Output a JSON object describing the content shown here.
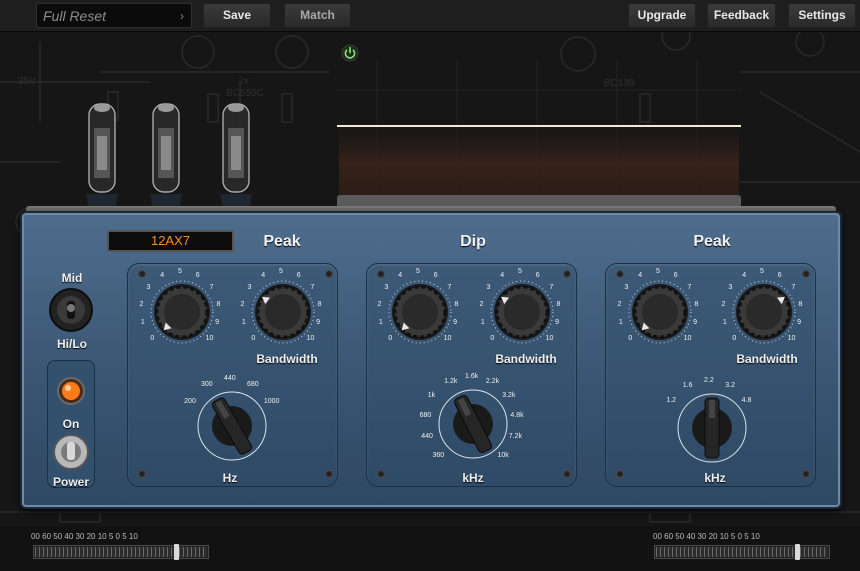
{
  "toolbar": {
    "preset_name": "Full Reset",
    "save_label": "Save",
    "match_label": "Match",
    "upgrade_label": "Upgrade",
    "feedback_label": "Feedback",
    "settings_label": "Settings"
  },
  "schematic_text": {
    "v35": "35V",
    "label_bc": "BC550C",
    "label_2x": "2x",
    "label_bd": "BD139"
  },
  "tube_type": "12AX7",
  "left_controls": {
    "mid_label": "Mid",
    "hilo_label": "Hi/Lo",
    "on_label": "On",
    "power_label": "Power"
  },
  "bands": [
    {
      "title": "Peak",
      "gain_ticks": [
        "0",
        "1",
        "2",
        "3",
        "4",
        "5",
        "6",
        "7",
        "8",
        "9",
        "10"
      ],
      "gain_value": 0,
      "bandwidth_label": "Bandwidth",
      "bandwidth_ticks": [
        "0",
        "1",
        "2",
        "3",
        "4",
        "5",
        "6",
        "7",
        "8",
        "9",
        "10"
      ],
      "bandwidth_value": 3,
      "freq_ticks": [
        "200",
        "300",
        "440",
        "680",
        "1000"
      ],
      "freq_value": "300",
      "freq_unit": "Hz"
    },
    {
      "title": "Dip",
      "gain_ticks": [
        "0",
        "1",
        "2",
        "3",
        "4",
        "5",
        "6",
        "7",
        "8",
        "9",
        "10"
      ],
      "gain_value": 0,
      "bandwidth_label": "Bandwidth",
      "bandwidth_ticks": [
        "0",
        "1",
        "2",
        "3",
        "4",
        "5",
        "6",
        "7",
        "8",
        "9",
        "10"
      ],
      "bandwidth_value": 3,
      "freq_ticks": [
        "360",
        "440",
        "680",
        "1k",
        "1.2k",
        "1.6k",
        "2.2k",
        "3.2k",
        "4.8k",
        "7.2k",
        "10k"
      ],
      "freq_value": "1.2k",
      "freq_unit": "kHz"
    },
    {
      "title": "Peak",
      "gain_ticks": [
        "0",
        "1",
        "2",
        "3",
        "4",
        "5",
        "6",
        "7",
        "8",
        "9",
        "10"
      ],
      "gain_value": 0,
      "bandwidth_label": "Bandwidth",
      "bandwidth_ticks": [
        "0",
        "1",
        "2",
        "3",
        "4",
        "5",
        "6",
        "7",
        "8",
        "9",
        "10"
      ],
      "bandwidth_value": 7,
      "freq_ticks": [
        "1.2",
        "1.6",
        "2.2",
        "3.2",
        "4.8"
      ],
      "freq_value": "2.2",
      "freq_unit": "kHz"
    }
  ],
  "meters": {
    "scale": [
      "00",
      "60",
      "50",
      "40",
      "30",
      "20",
      "10",
      "5",
      "0",
      "5",
      "10"
    ],
    "input_value": 0,
    "output_value": 0
  },
  "colors": {
    "panel": "#3a5673",
    "tube_display_text": "#f2902a",
    "power_icon": "#8fe07a",
    "power_lamp": "#ff7a1a"
  }
}
